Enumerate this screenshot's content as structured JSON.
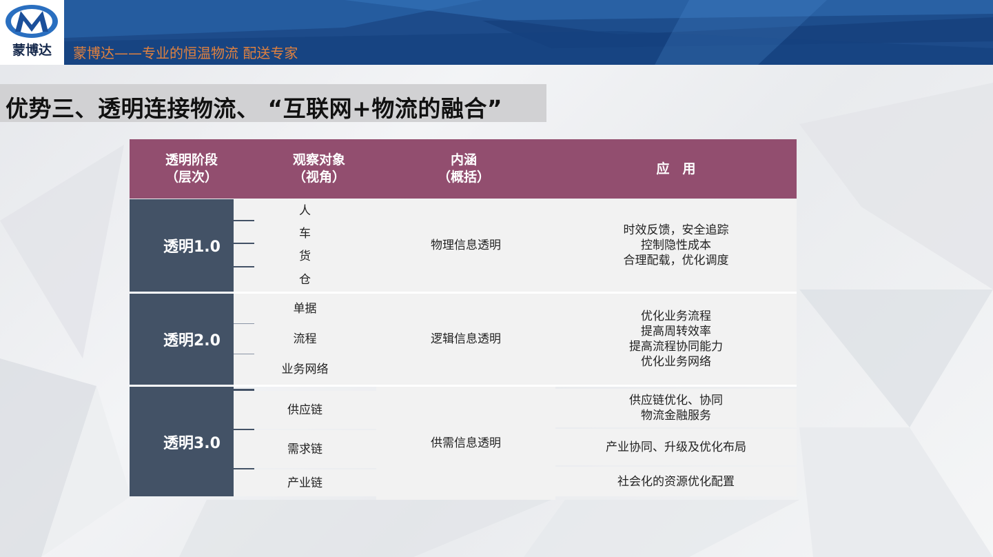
{
  "header": {
    "logo_text": "蒙博达",
    "tagline": "蒙博达——专业的恒温物流 配送专家"
  },
  "title": "优势三、透明连接物流、 “互联网+物流的融合”",
  "table": {
    "headers": [
      {
        "line1": "透明阶段",
        "line2": "（层次）"
      },
      {
        "line1": "观察对象",
        "line2": "（视角）"
      },
      {
        "line1": "内涵",
        "line2": "（概括）"
      },
      {
        "line1": "应　用",
        "line2": ""
      }
    ],
    "rows": [
      {
        "stage": "透明1.0",
        "objects": [
          "人",
          "车",
          "货",
          "仓"
        ],
        "meaning": "物理信息透明",
        "applications": [
          "时效反馈，安全追踪",
          "控制隐性成本",
          "合理配载，优化调度"
        ]
      },
      {
        "stage": "透明2.0",
        "objects": [
          "单据",
          "流程",
          "业务网络"
        ],
        "meaning": "逻辑信息透明",
        "applications": [
          "优化业务流程",
          "提高周转效率",
          "提高流程协同能力",
          "优化业务网络"
        ]
      },
      {
        "stage": "透明3.0",
        "objects": [
          "供应链",
          "需求链",
          "产业链"
        ],
        "meaning": "供需信息透明",
        "applications": [
          "供应链优化、协同",
          "物流金融服务",
          "产业协同、升级及优化布局",
          "社会化的资源优化配置"
        ]
      }
    ]
  },
  "colors": {
    "header_bg": "#1f4f8e",
    "tagline": "#e0813f",
    "table_header": "#924e6f",
    "stage_cell": "#435266",
    "cell_bg": "#f2f2f2"
  }
}
